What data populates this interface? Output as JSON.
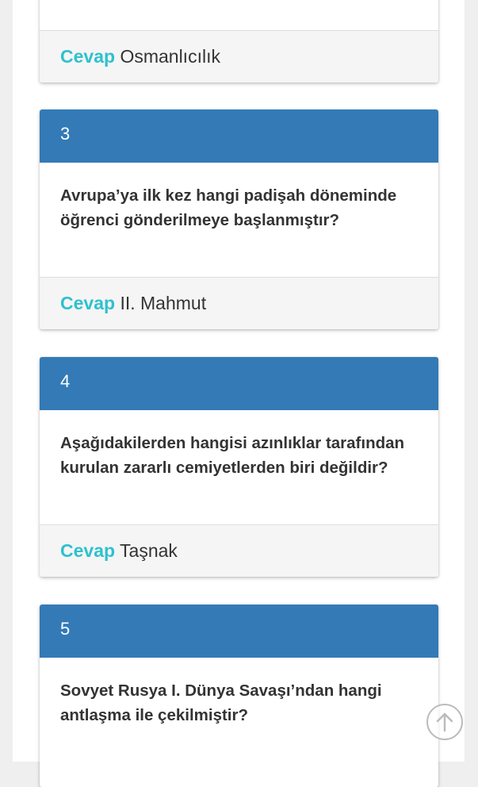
{
  "cards": [
    {
      "answer_label": "Cevap",
      "answer_value": "Osmanlıcılık"
    },
    {
      "number": "3",
      "question": "Avrupa’ya ilk kez hangi padişah döneminde öğrenci gönderilmeye başlanmıştır?",
      "answer_label": "Cevap",
      "answer_value": "II. Mahmut"
    },
    {
      "number": "4",
      "question": "Aşağıdakilerden hangisi azınlıklar tarafından kurulan zararlı cemiyetlerden biri değildir?",
      "answer_label": "Cevap",
      "answer_value": "Taşnak"
    },
    {
      "number": "5",
      "question": "Sovyet Rusya I. Dünya Savaşı’ndan hangi antlaşma ile çekilmiştir?"
    }
  ],
  "scroll_top_icon": "arrow-up-circle-icon"
}
